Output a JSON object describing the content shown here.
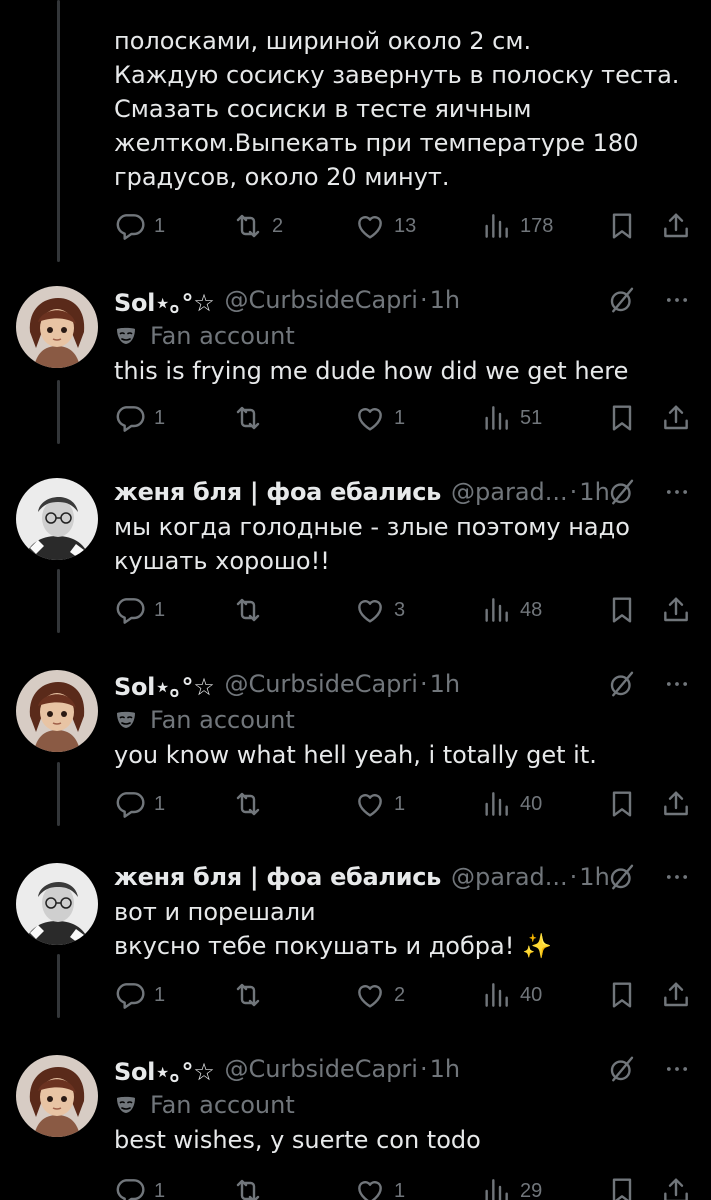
{
  "tweets": [
    {
      "text": "полосками, шириной около 2 см.\nКаждую сосиску завернуть в полоску теста.\nСмазать сосиски в тесте яичным\nжелтком.Выпекать при температуре 180\nградусов, около 20 минут.",
      "replies": "1",
      "reposts": "2",
      "likes": "13",
      "views": "178"
    },
    {
      "name": "Sol⋆｡°☆",
      "handle": "@CurbsideCapri",
      "time": "1h",
      "badge": "Fan account",
      "text": "this is frying me dude how did we get here",
      "replies": "1",
      "reposts": "",
      "likes": "1",
      "views": "51"
    },
    {
      "name": "женя бля | фоа ебались",
      "handle": "@parad...",
      "time": "1h",
      "text": "мы когда голодные - злые поэтому надо\nкушать хорошо!!",
      "replies": "1",
      "reposts": "",
      "likes": "3",
      "views": "48"
    },
    {
      "name": "Sol⋆｡°☆",
      "handle": "@CurbsideCapri",
      "time": "1h",
      "badge": "Fan account",
      "text": "you know what hell yeah, i totally get it.",
      "replies": "1",
      "reposts": "",
      "likes": "1",
      "views": "40"
    },
    {
      "name": "женя бля | фоа ебались",
      "handle": "@parad...",
      "time": "1h",
      "text": "вот и порешали\nвкусно тебе покушать и добра! ✨",
      "replies": "1",
      "reposts": "",
      "likes": "2",
      "views": "40"
    },
    {
      "name": "Sol⋆｡°☆",
      "handle": "@CurbsideCapri",
      "time": "1h",
      "badge": "Fan account",
      "text": "best wishes, y suerte con todo",
      "replies": "1",
      "reposts": "",
      "likes": "1",
      "views": "29"
    }
  ],
  "meta": {
    "dot": "·"
  },
  "icons": [
    "reply-icon",
    "repost-icon",
    "like-icon",
    "views-icon",
    "bookmark-icon",
    "share-icon",
    "grok-icon",
    "more-icon",
    "mask-icon"
  ],
  "colors": {
    "background": "#000000",
    "text": "#e7e9ea",
    "muted": "#71767b",
    "thread_line": "#333639"
  }
}
